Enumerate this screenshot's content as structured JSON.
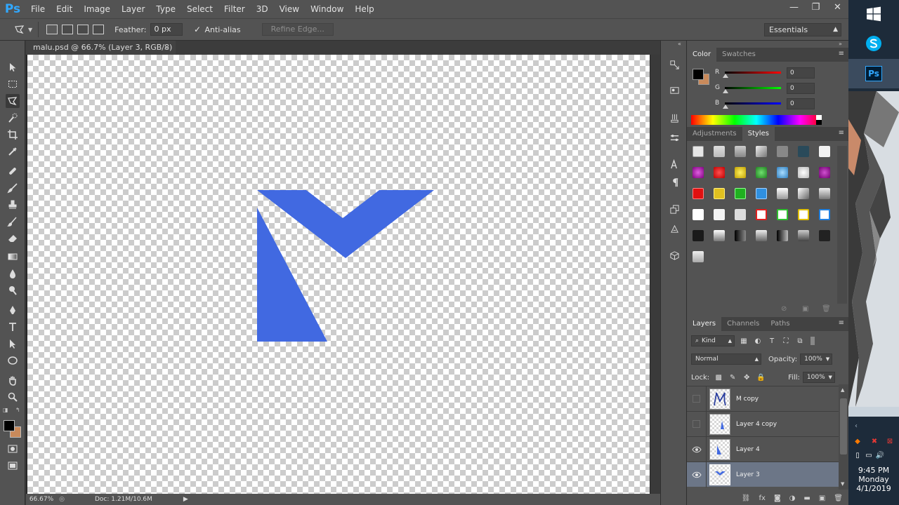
{
  "menubar": {
    "logo": "Ps",
    "items": [
      "File",
      "Edit",
      "Image",
      "Layer",
      "Type",
      "Select",
      "Filter",
      "3D",
      "View",
      "Window",
      "Help"
    ],
    "minimize": "—",
    "restore": "❐",
    "close": "✕"
  },
  "options": {
    "feather_label": "Feather:",
    "feather_value": "0 px",
    "antialias_label": "Anti-alias",
    "antialias_checked": "✓",
    "refine_edge": "Refine Edge...",
    "workspace": "Essentials"
  },
  "document": {
    "tab_title": "malu.psd @ 66.7% (Layer 3, RGB/8) *",
    "tab_close": "×",
    "zoom": "66.67%",
    "doc_info": "Doc: 1.21M/10.6M",
    "shape_color": "#4169e1"
  },
  "color_panel": {
    "tabs": [
      "Color",
      "Swatches"
    ],
    "r_label": "R",
    "g_label": "G",
    "b_label": "B",
    "r_value": "0",
    "g_value": "0",
    "b_value": "0",
    "foreground": "#000000",
    "background": "#c98a5b"
  },
  "styles_panel": {
    "tabs": [
      "Adjustments",
      "Styles"
    ]
  },
  "layers_panel": {
    "tabs": [
      "Layers",
      "Channels",
      "Paths"
    ],
    "filter_kind": "Kind",
    "blend_mode": "Normal",
    "opacity_label": "Opacity:",
    "opacity_value": "100%",
    "lock_label": "Lock:",
    "fill_label": "Fill:",
    "fill_value": "100%",
    "layers": [
      {
        "name": "M copy",
        "visible": false,
        "selected": false
      },
      {
        "name": "Layer 4 copy",
        "visible": false,
        "selected": false
      },
      {
        "name": "Layer 4",
        "visible": true,
        "selected": false
      },
      {
        "name": "Layer 3",
        "visible": true,
        "selected": true
      }
    ]
  },
  "taskbar": {
    "time": "9:45 PM",
    "day": "Monday",
    "date": "4/1/2019",
    "ps_label": "Ps"
  }
}
